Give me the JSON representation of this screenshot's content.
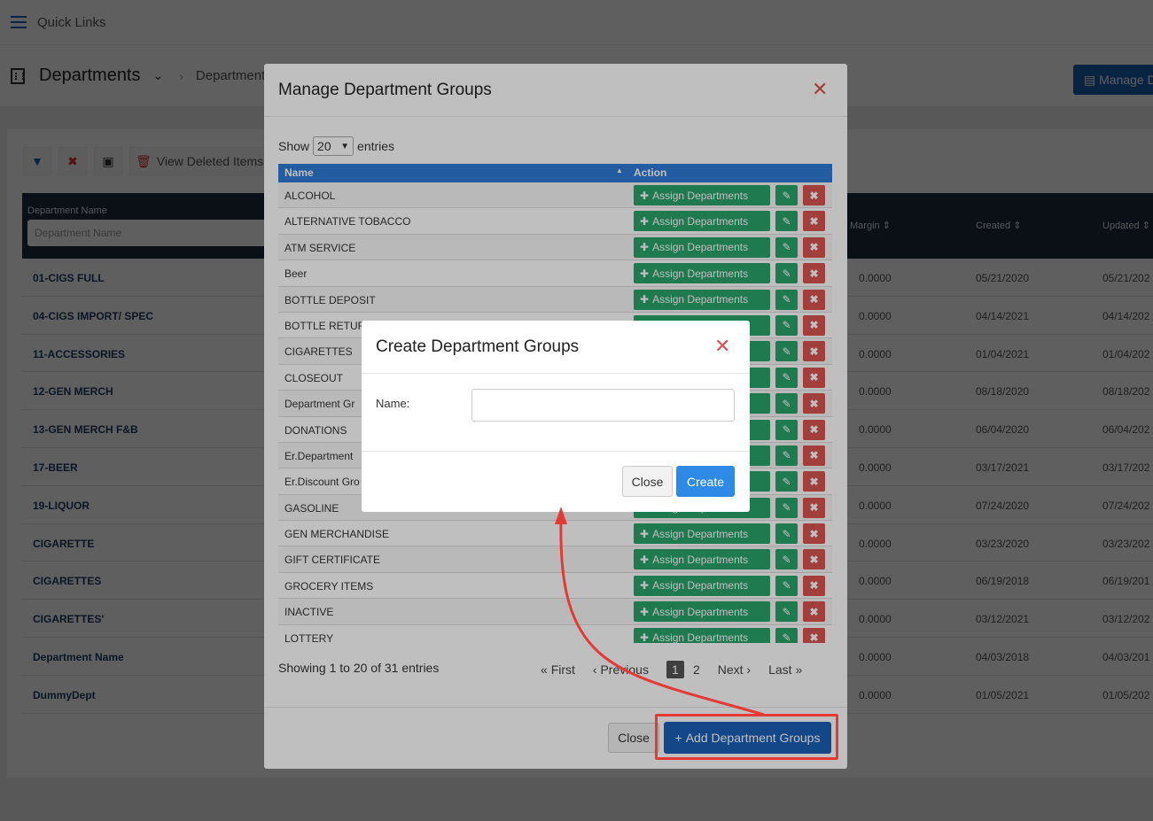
{
  "topbar": {
    "quick_links": "Quick Links"
  },
  "pagebar": {
    "title": "Departments",
    "crumb": "Departments",
    "manage_button": "Manage D"
  },
  "toolbar": {
    "view_deleted": "View Deleted Items"
  },
  "bg_table": {
    "filter_label": "Department Name",
    "filter_placeholder": "Department Name",
    "columns": [
      "Margin",
      "Created",
      "Updated"
    ],
    "rows": [
      {
        "name": "01-CIGS FULL",
        "margin": "0.0000",
        "created": "05/21/2020",
        "updated": "05/21/202"
      },
      {
        "name": "04-CIGS IMPORT/ SPEC",
        "margin": "0.0000",
        "created": "04/14/2021",
        "updated": "04/14/202"
      },
      {
        "name": "11-ACCESSORIES",
        "margin": "0.0000",
        "created": "01/04/2021",
        "updated": "01/04/202"
      },
      {
        "name": "12-GEN MERCH",
        "margin": "0.0000",
        "created": "08/18/2020",
        "updated": "08/18/202"
      },
      {
        "name": "13-GEN MERCH F&B",
        "margin": "0.0000",
        "created": "06/04/2020",
        "updated": "06/04/202"
      },
      {
        "name": "17-BEER",
        "margin": "0.0000",
        "created": "03/17/2021",
        "updated": "03/17/202"
      },
      {
        "name": "19-LIQUOR",
        "margin": "0.0000",
        "created": "07/24/2020",
        "updated": "07/24/202"
      },
      {
        "name": "CIGARETTE",
        "margin": "0.0000",
        "created": "03/23/2020",
        "updated": "03/23/202"
      },
      {
        "name": "CIGARETTES",
        "margin": "0.0000",
        "created": "06/19/2018",
        "updated": "06/19/201"
      },
      {
        "name": "CIGARETTES'",
        "margin": "0.0000",
        "created": "03/12/2021",
        "updated": "03/12/202"
      },
      {
        "name": "Department Name",
        "margin": "0.0000",
        "created": "04/03/2018",
        "updated": "04/03/201"
      },
      {
        "name": "DummyDept",
        "margin": "0.0000",
        "created": "01/05/2021",
        "updated": "01/05/202"
      }
    ]
  },
  "manage_modal": {
    "title": "Manage Department Groups",
    "show_label": "Show",
    "entries_value": "20",
    "entries_label": "entries",
    "col_name": "Name",
    "col_action": "Action",
    "assign_label": "Assign Departments",
    "rows": [
      "ALCOHOL",
      "ALTERNATIVE TOBACCO",
      "ATM SERVICE",
      "Beer",
      "BOTTLE DEPOSIT",
      "BOTTLE RETURN",
      "CIGARETTES",
      "CLOSEOUT",
      "Department Gr",
      "DONATIONS",
      "Er.Department",
      "Er.Discount Gro",
      "GASOLINE",
      "GEN MERCHANDISE",
      "GIFT CERTIFICATE",
      "GROCERY ITEMS",
      "INACTIVE",
      "LOTTERY"
    ],
    "info": "Showing 1 to 20 of 31 entries",
    "pagination": {
      "first": "First",
      "previous": "Previous",
      "pages": [
        "1",
        "2"
      ],
      "next": "Next",
      "last": "Last"
    },
    "close_label": "Close",
    "add_label": "Add Department Groups"
  },
  "create_modal": {
    "title": "Create Department Groups",
    "name_label": "Name:",
    "name_value": "",
    "close_label": "Close",
    "create_label": "Create"
  },
  "colors": {
    "primary": "#1a5fb4",
    "success": "#2aa36b",
    "danger": "#d9534f",
    "annotation": "#e53935"
  }
}
